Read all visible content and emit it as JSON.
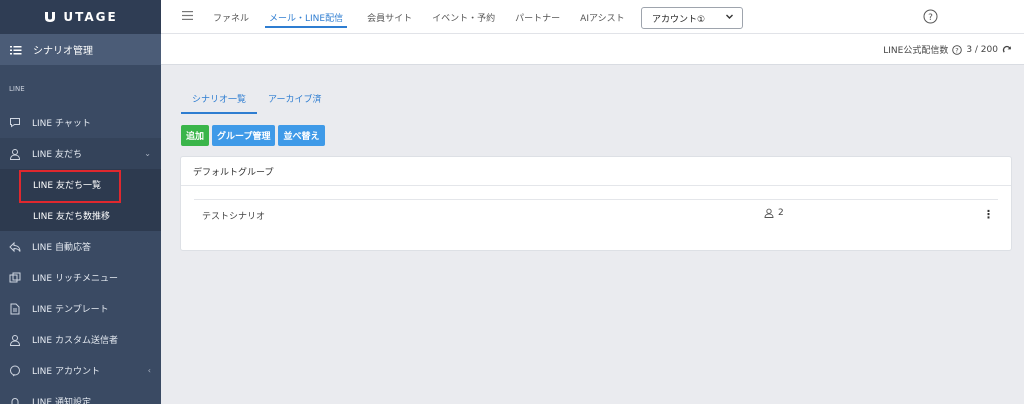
{
  "brand": {
    "name": "UTAGE"
  },
  "sidebar": {
    "header": "シナリオ管理",
    "section": "LINE",
    "items": [
      {
        "label": "LINE チャット",
        "icon": "chat-icon"
      },
      {
        "label": "LINE 友だち",
        "icon": "user-icon",
        "expanded": true
      },
      {
        "label": "LINE 自動応答",
        "icon": "reply-icon"
      },
      {
        "label": "LINE リッチメニュー",
        "icon": "rich-menu-icon"
      },
      {
        "label": "LINE テンプレート",
        "icon": "template-icon"
      },
      {
        "label": "LINE カスタム送信者",
        "icon": "custom-sender-icon"
      },
      {
        "label": "LINE アカウント",
        "icon": "account-icon"
      },
      {
        "label": "LINE 通知設定",
        "icon": "bell-icon"
      }
    ],
    "sub_items": [
      {
        "label": "LINE 友だち一覧",
        "highlighted": true
      },
      {
        "label": "LINE 友だち数推移"
      }
    ]
  },
  "topnav": {
    "items": [
      "ファネル",
      "メール・LINE配信",
      "会員サイト",
      "イベント・予約",
      "パートナー",
      "AIアシスト"
    ],
    "active_index": 1,
    "account_select": "アカウント①"
  },
  "quota": {
    "label": "LINE公式配信数",
    "value": "3 / 200"
  },
  "tabs": [
    "シナリオ一覧",
    "アーカイブ済"
  ],
  "buttons": {
    "add": "追加",
    "group": "グループ管理",
    "sort": "並べ替え"
  },
  "group": {
    "title": "デフォルトグループ",
    "scenarios": [
      {
        "name": "テストシナリオ",
        "count": "2"
      }
    ]
  },
  "colors": {
    "sidebar": "#3a4a63",
    "accent": "#2e7dd1",
    "green": "#3ab54a",
    "highlight": "#e0282e"
  }
}
